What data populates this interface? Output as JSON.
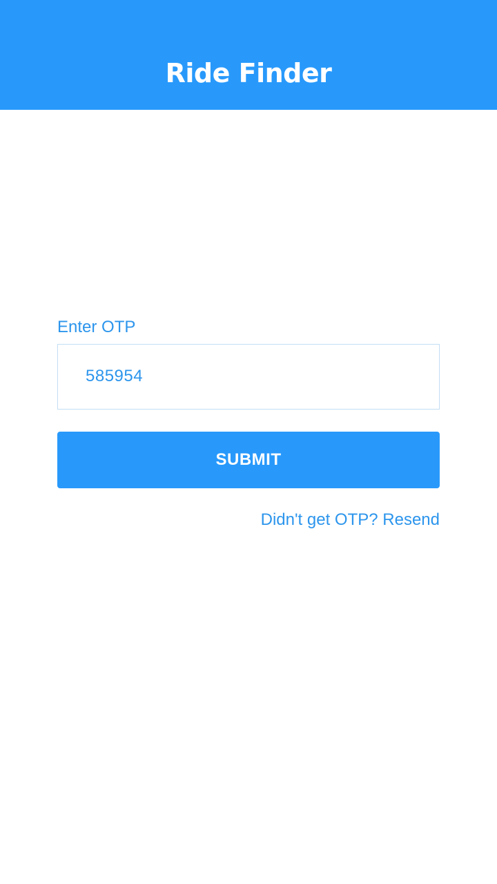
{
  "header": {
    "title": "Ride Finder"
  },
  "otp_form": {
    "label": "Enter OTP",
    "value": "585954",
    "submit_label": "SUBMIT",
    "resend_prompt": "Didn't get OTP? Resend"
  },
  "colors": {
    "primary": "#2899fb",
    "text_accent": "#2c95ec",
    "field_border": "#c2def5",
    "background": "#ffffff"
  }
}
